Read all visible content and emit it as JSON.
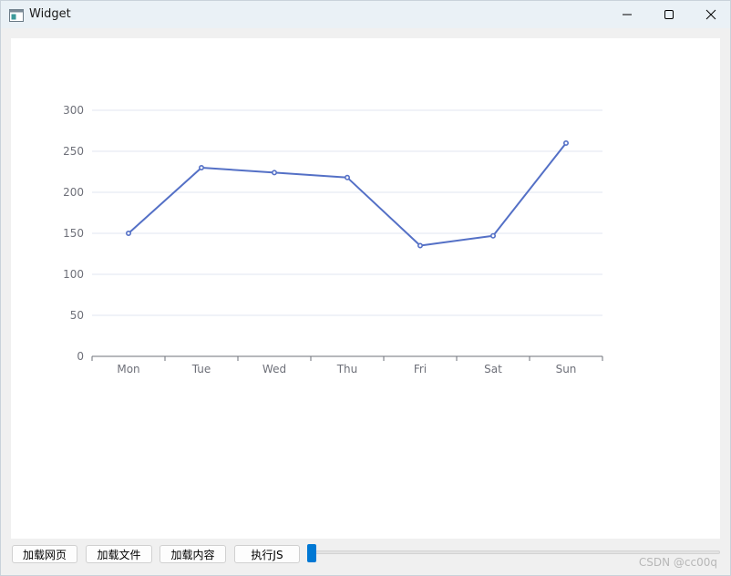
{
  "window": {
    "title": "Widget",
    "minimize_icon": "minimize-icon",
    "maximize_icon": "maximize-icon",
    "close_icon": "close-icon"
  },
  "chart_data": {
    "type": "line",
    "categories": [
      "Mon",
      "Tue",
      "Wed",
      "Thu",
      "Fri",
      "Sat",
      "Sun"
    ],
    "values": [
      150,
      230,
      224,
      218,
      135,
      147,
      260
    ],
    "ylim": [
      0,
      300
    ],
    "yticks": [
      0,
      50,
      100,
      150,
      200,
      250,
      300
    ],
    "grid": true,
    "line_color": "#5470c6",
    "title": "",
    "xlabel": "",
    "ylabel": ""
  },
  "toolbar": {
    "load_webpage": "加载网页",
    "load_file": "加载文件",
    "load_content": "加载内容",
    "execute_js": "执行JS"
  },
  "slider": {
    "value": 0
  },
  "watermark": "CSDN @cc00q"
}
